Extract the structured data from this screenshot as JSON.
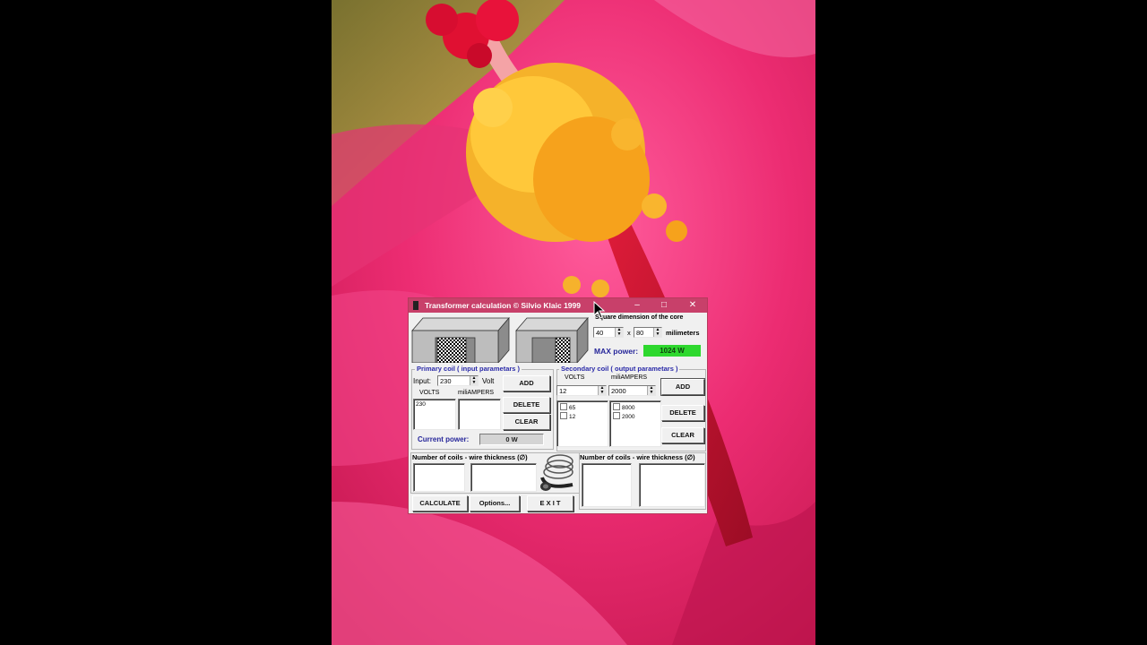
{
  "window": {
    "title": "Transformer calculation © Silvio Klaic 1999",
    "minimize_glyph": "–",
    "maximize_glyph": "□",
    "close_glyph": "✕"
  },
  "core": {
    "label_top": "Square dimension of the core",
    "dim_a": "40",
    "x_label": "x",
    "dim_b": "80",
    "unit": "milimeters",
    "max_power_label": "MAX power:",
    "max_power_value": "1024 W",
    "max_power_color": "#2ed82e"
  },
  "primary": {
    "legend": "Primary coil ( input parametars )",
    "input_label": "Input:",
    "input_value": "230",
    "volt_label": "Volt",
    "volts_header": "VOLTS",
    "milliamps_header": "miliAMPERS",
    "volts_list": [
      "230"
    ],
    "add_label": "ADD",
    "delete_label": "DELETE",
    "clear_label": "CLEAR",
    "current_power_label": "Current power:",
    "current_power_value": "0 W"
  },
  "secondary": {
    "legend": "Secondary coil ( output parametars )",
    "volts_header": "VOLTS",
    "milliamps_header": "miliAMPERS",
    "volts_value": "12",
    "milliamps_value": "2000",
    "volts_list": [
      "65",
      "12"
    ],
    "milliamps_list": [
      "8000",
      "2000"
    ],
    "add_label": "ADD",
    "delete_label": "DELETE",
    "clear_label": "CLEAR"
  },
  "results": {
    "left_header": "Number of coils - wire thickness (∅)",
    "right_header": "Number of coils - wire thickness (∅)"
  },
  "bottom": {
    "calculate_label": "CALCULATE",
    "options_label": "Options...",
    "exit_label": "E X I T"
  },
  "icons": {
    "core_image": "transformer-core-icon",
    "coil_image": "wire-coil-icon",
    "cursor": "mouse-pointer-icon"
  }
}
